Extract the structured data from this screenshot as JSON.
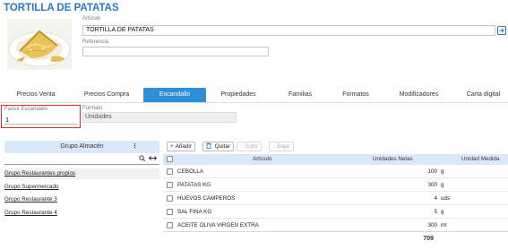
{
  "page": {
    "title": "TORTILLA DE PATATAS"
  },
  "article": {
    "articulo_label": "Artículo",
    "articulo_value": "TORTILLA DE PATATAS",
    "referencia_label": "Referencia",
    "referencia_value": "",
    "lookup_icon": "open-in-window-icon"
  },
  "tabs": [
    {
      "label": "Precios Venta"
    },
    {
      "label": "Precios Compra"
    },
    {
      "label": "Escandallo",
      "active": true
    },
    {
      "label": "Propiedades"
    },
    {
      "label": "Familias"
    },
    {
      "label": "Formatos"
    },
    {
      "label": "Modificadores"
    },
    {
      "label": "Carta digital"
    }
  ],
  "escandallo": {
    "factor_label": "Factor Escandallo",
    "factor_value": "1",
    "formato_label": "Formato",
    "formato_value": "Unidades"
  },
  "grupo_almacen": {
    "header": "Grupo Almacén",
    "menu_icon": "kebab-menu-icon",
    "search_icons": [
      "search-icon",
      "expand-arrows-icon"
    ],
    "items": [
      {
        "label": "Grupo Restaurantes propios",
        "selected": true
      },
      {
        "label": "Grupo Supermercado"
      },
      {
        "label": "Grupo Restaurante 3"
      },
      {
        "label": "Grupo Restaurante 4"
      }
    ]
  },
  "toolbar": {
    "add_label": "Añadir",
    "remove_label": "Quitar",
    "up_label": "Subir",
    "down_label": "Bajar"
  },
  "products": {
    "columns": {
      "articulo": "Artículo",
      "unidades": "Unidades Netas",
      "medida": "Unidad Medida"
    },
    "rows": [
      {
        "name": "CEBOLLA",
        "qty": "100",
        "unit": "g"
      },
      {
        "name": "PATATAS KG",
        "qty": "300",
        "unit": "g"
      },
      {
        "name": "HUEVOS CAMPEROS",
        "qty": "4",
        "unit": "uds"
      },
      {
        "name": "SAL FINA KG",
        "qty": "5",
        "unit": "g"
      },
      {
        "name": "ACEITE OLIVA VIRGEN EXTRA",
        "qty": "300",
        "unit": "ml"
      }
    ],
    "total": "709"
  },
  "colors": {
    "accent": "#2878c8",
    "active_tab": "#2f8fd6",
    "header_bg": "#d9e9fb",
    "error_border": "#d93030"
  }
}
